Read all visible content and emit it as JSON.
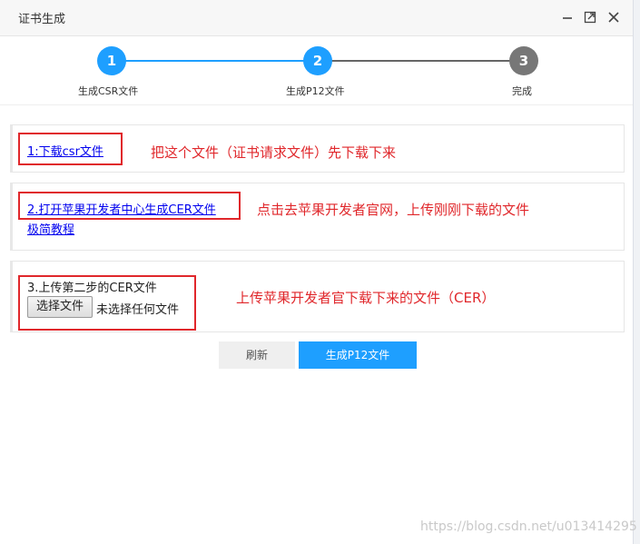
{
  "window": {
    "title": "证书生成"
  },
  "steps": [
    {
      "number": "1",
      "label": "生成CSR文件",
      "state": "done"
    },
    {
      "number": "2",
      "label": "生成P12文件",
      "state": "current"
    },
    {
      "number": "3",
      "label": "完成",
      "state": "pending"
    }
  ],
  "panel1": {
    "link": "1:下载csr文件",
    "annotation": "把这个文件（证书请求文件）先下载下来"
  },
  "panel2": {
    "link": "2.打开苹果开发者中心生成CER文件",
    "tutorial_link": "极简教程",
    "annotation": "点击去苹果开发者官网，上传刚刚下载的文件"
  },
  "panel3": {
    "label": "3.上传第二步的CER文件",
    "file_button": "选择文件",
    "file_status": "未选择任何文件",
    "annotation": "上传苹果开发者官下载下来的文件（CER）"
  },
  "actions": {
    "refresh": "刷新",
    "generate": "生成P12文件"
  },
  "watermark": "https://blog.csdn.net/u013414295",
  "colors": {
    "accent": "#1e9fff",
    "annotation_red": "#e0272b",
    "pending_gray": "#777777"
  }
}
